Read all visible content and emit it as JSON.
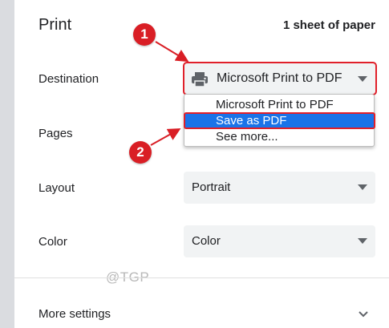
{
  "header": {
    "title": "Print",
    "sheet_info": "1 sheet of paper"
  },
  "destination": {
    "label": "Destination",
    "selected": "Microsoft Print to PDF",
    "icon": "printer-icon",
    "options": [
      "Microsoft Print to PDF",
      "Save as PDF",
      "See more..."
    ],
    "highlighted_option": "Save as PDF"
  },
  "pages": {
    "label": "Pages"
  },
  "layout": {
    "label": "Layout",
    "selected": "Portrait"
  },
  "color": {
    "label": "Color",
    "selected": "Color"
  },
  "more_settings": {
    "label": "More settings",
    "icon": "chevron-down-icon"
  },
  "annotations": {
    "step1": "1",
    "step2": "2",
    "highlight_color": "#e0202a"
  },
  "watermark": "@TGP",
  "colors": {
    "accent": "#1a73e8",
    "select_bg": "#f1f3f4",
    "annotation_red": "#d91e25"
  }
}
